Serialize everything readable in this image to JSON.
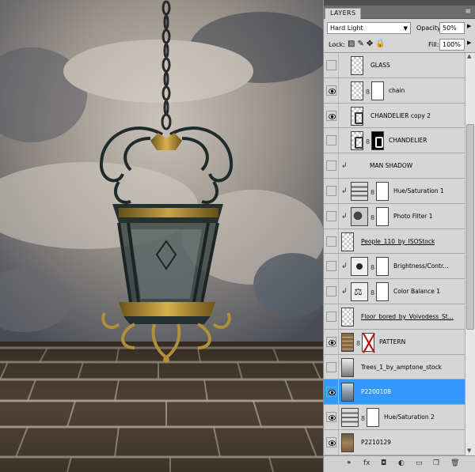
{
  "panel": {
    "tab_label": "LAYERS",
    "menu_icon": "panel-menu-icon",
    "blend_mode": "Hard Light",
    "opacity_label": "Opacity:",
    "opacity_value": "50%",
    "lock_label": "Lock:",
    "fill_label": "Fill:",
    "fill_value": "100%"
  },
  "layers": [
    {
      "name": "GLASS",
      "visible": false,
      "thumb": "chk",
      "clip": false,
      "mask": null,
      "selected": false,
      "underline": false,
      "indent": true
    },
    {
      "name": "chain",
      "visible": true,
      "thumb": "chk",
      "clip": false,
      "mask": "white",
      "selected": false,
      "underline": false,
      "indent": true
    },
    {
      "name": "CHANDELIER copy 2",
      "visible": true,
      "thumb": "chand",
      "clip": false,
      "mask": null,
      "selected": false,
      "underline": false,
      "indent": true
    },
    {
      "name": "CHANDELIER",
      "visible": false,
      "thumb": "chand",
      "clip": false,
      "mask": "black",
      "selected": false,
      "underline": false,
      "indent": true
    },
    {
      "name": "MAN SHADOW",
      "visible": false,
      "thumb": null,
      "clip": true,
      "mask": null,
      "selected": false,
      "underline": false,
      "indent": true
    },
    {
      "name": "Hue/Saturation 1",
      "visible": false,
      "thumb": "adj",
      "clip": true,
      "mask": "white",
      "selected": false,
      "underline": false,
      "indent": true
    },
    {
      "name": "Photo Filter 1",
      "visible": false,
      "thumb": "pf",
      "clip": true,
      "mask": "white",
      "selected": false,
      "underline": false,
      "indent": true
    },
    {
      "name": "People_110_by_ISOStock",
      "visible": false,
      "thumb": "chk",
      "clip": false,
      "mask": null,
      "selected": false,
      "underline": true,
      "indent": false
    },
    {
      "name": "Brightness/Contr...",
      "visible": false,
      "thumb": "bc",
      "clip": true,
      "mask": "white",
      "selected": false,
      "underline": false,
      "indent": true
    },
    {
      "name": "Color Balance 1",
      "visible": false,
      "thumb": "cb",
      "clip": true,
      "mask": "white",
      "selected": false,
      "underline": false,
      "indent": true
    },
    {
      "name": "Floor_bored_by_Voivodess_St...",
      "visible": false,
      "thumb": "chk",
      "clip": false,
      "mask": null,
      "selected": false,
      "underline": true,
      "indent": false
    },
    {
      "name": "PATTERN",
      "visible": true,
      "thumb": "brick",
      "clip": false,
      "mask": "redx",
      "selected": false,
      "underline": false,
      "indent": false
    },
    {
      "name": "Trees_1_by_amptone_stock",
      "visible": false,
      "thumb": "tree",
      "clip": false,
      "mask": null,
      "selected": false,
      "underline": false,
      "indent": false
    },
    {
      "name": "P2200108",
      "visible": true,
      "thumb": "sel",
      "clip": false,
      "mask": null,
      "selected": true,
      "underline": false,
      "indent": false
    },
    {
      "name": "Hue/Saturation 2",
      "visible": true,
      "thumb": "adj",
      "clip": false,
      "mask": "white",
      "selected": false,
      "underline": false,
      "indent": false
    },
    {
      "name": "P2210129",
      "visible": true,
      "thumb": "photo",
      "clip": false,
      "mask": null,
      "selected": false,
      "underline": false,
      "indent": false
    }
  ],
  "footer_icons": [
    "link-layers-icon",
    "fx-icon",
    "add-mask-icon",
    "adjustment-icon",
    "group-icon",
    "new-layer-icon",
    "trash-icon"
  ],
  "colors": {
    "selected": "#3399ff",
    "panel_bg": "#d6d6d6"
  }
}
